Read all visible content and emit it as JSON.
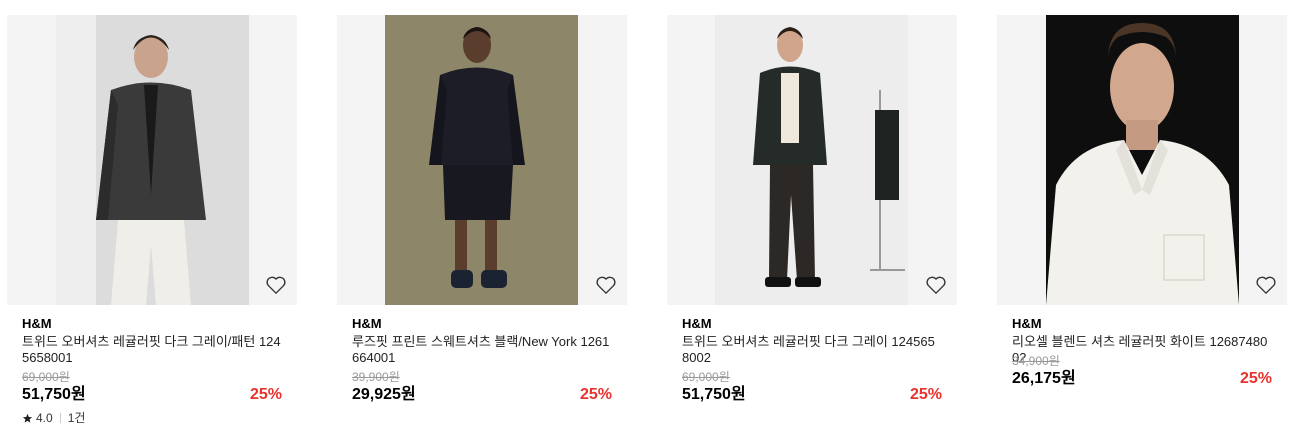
{
  "products": [
    {
      "brand": "H&M",
      "name": "트위드 오버셔츠 레귤러핏 다크 그레이/패턴 1245658001",
      "original_price": "69,000원",
      "price": "51,750원",
      "discount": "25%",
      "rating": "4.0",
      "review_count": "1건",
      "photo_bg": "#d8d8d8"
    },
    {
      "brand": "H&M",
      "name": "루즈핏 프린트 스웨트셔츠 블랙/New York 1261664001",
      "original_price": "39,900원",
      "price": "29,925원",
      "discount": "25%",
      "photo_bg": "#8c8466"
    },
    {
      "brand": "H&M",
      "name": "트위드 오버셔츠 레귤러핏 다크 그레이 1245658002",
      "original_price": "69,000원",
      "price": "51,750원",
      "discount": "25%",
      "photo_bg": "#ececec"
    },
    {
      "brand": "H&M",
      "name": "리오셀 블렌드 셔츠 레귤러핏 화이트 1268748002",
      "original_price": "34,900원",
      "price": "26,175원",
      "discount": "25%",
      "photo_bg": "#111111"
    }
  ],
  "icons": {
    "wishlist": "heart-outline-icon",
    "rating": "star-icon"
  },
  "colors": {
    "discount": "#e8322c",
    "strike_price": "#999999"
  }
}
